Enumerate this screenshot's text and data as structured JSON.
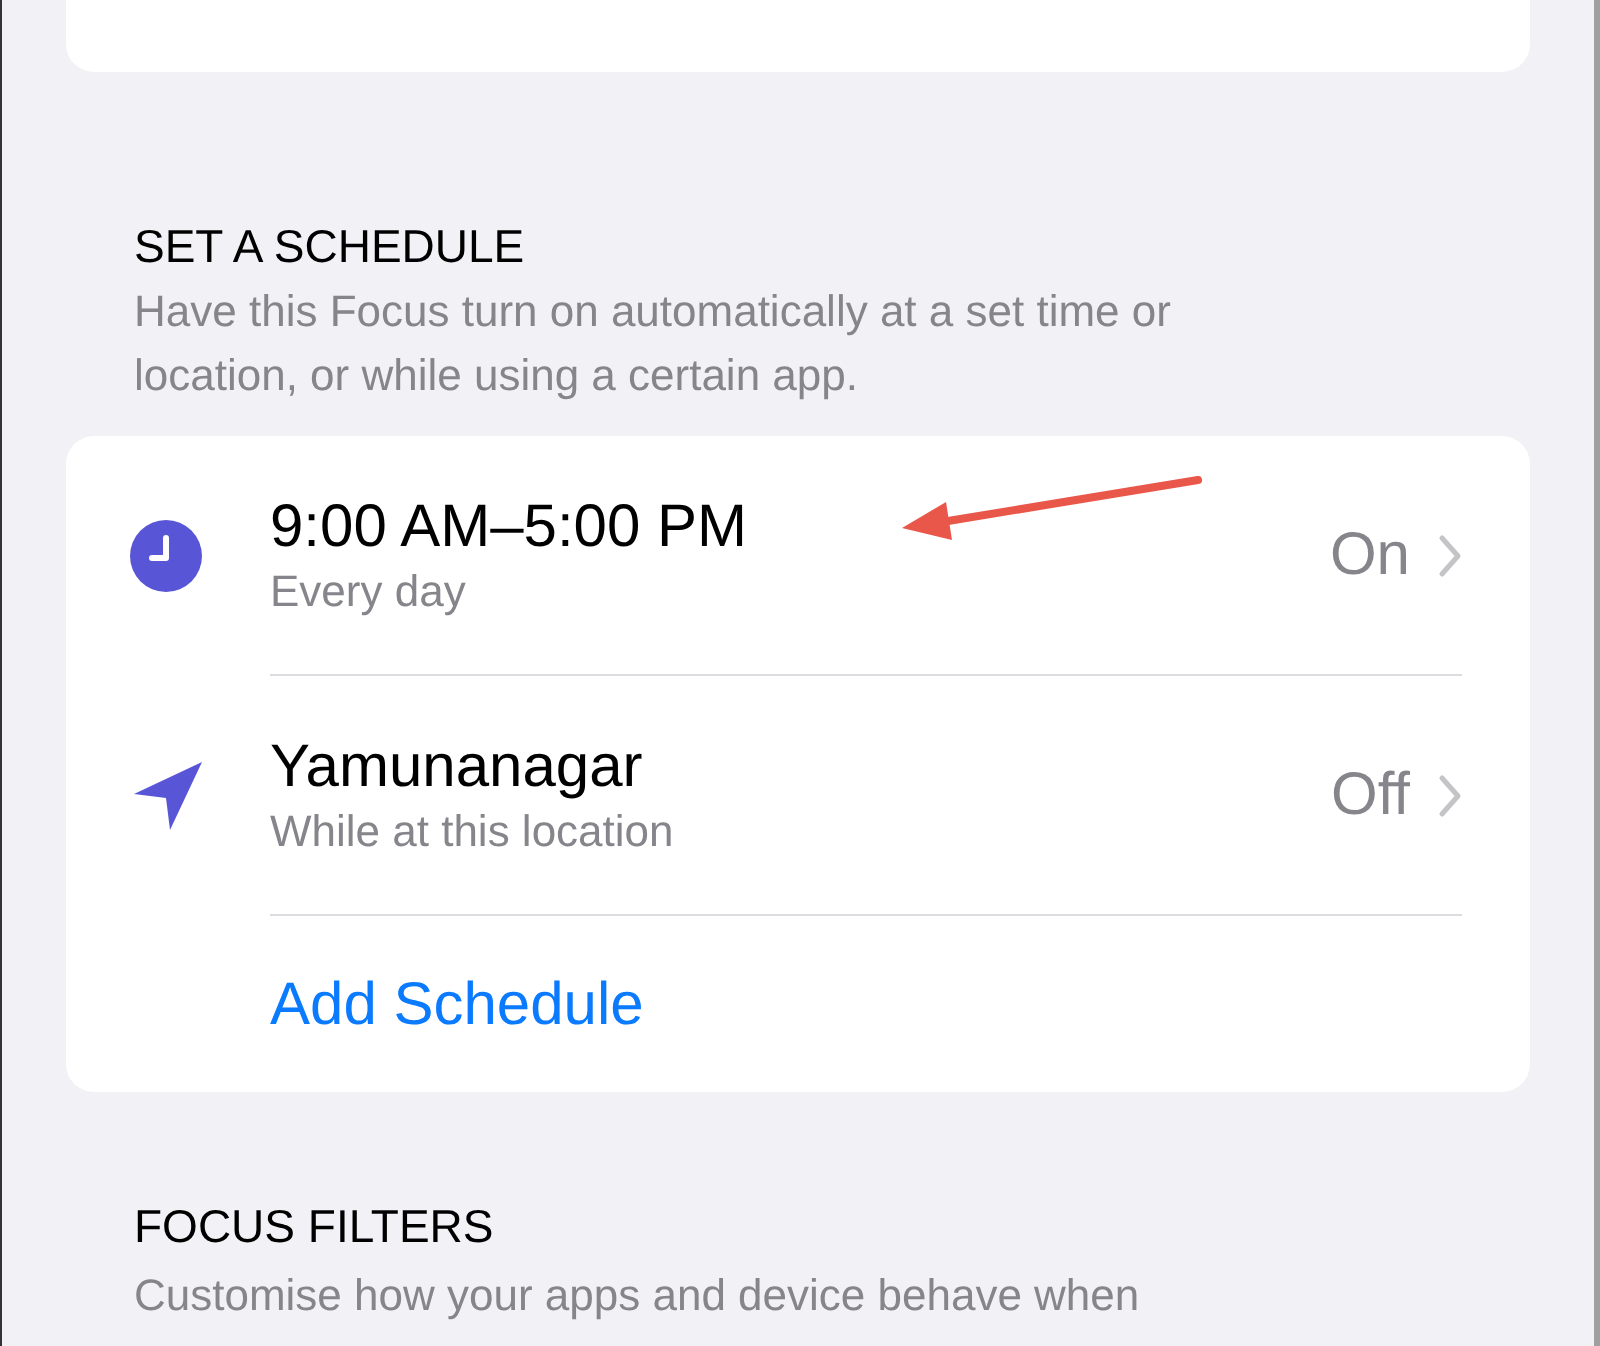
{
  "schedule": {
    "heading": "SET A SCHEDULE",
    "description": "Have this Focus turn on automatically at a set time or location, or while using a certain app.",
    "rows": [
      {
        "kind": "clock",
        "title": "9:00 AM–5:00 PM",
        "subtitle": "Every day",
        "status": "On",
        "annotated": true
      },
      {
        "kind": "location",
        "title": "Yamunanagar",
        "subtitle": "While at this location",
        "status": "Off",
        "annotated": false
      }
    ],
    "add_label": "Add Schedule"
  },
  "filters": {
    "heading": "FOCUS FILTERS",
    "description": "Customise how your apps and device behave when"
  }
}
